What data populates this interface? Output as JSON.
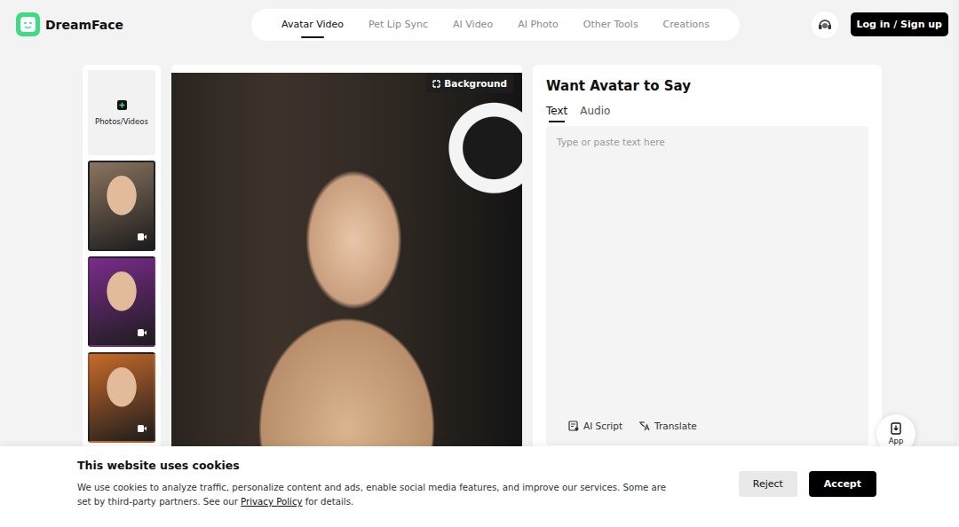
{
  "header": {
    "logo": "DreamFace",
    "nav": [
      {
        "label": "Avatar Video",
        "selected": true
      },
      {
        "label": "Pet Lip Sync",
        "selected": false
      },
      {
        "label": "AI Video",
        "selected": false
      },
      {
        "label": "AI Photo",
        "selected": false
      },
      {
        "label": "Other Tools",
        "selected": false
      },
      {
        "label": "Creations",
        "selected": false
      }
    ],
    "login": "Log in / Sign up"
  },
  "media": {
    "upload": "Photos/Videos",
    "thumbnails": [
      {
        "selected": true,
        "color": "#8a7460"
      },
      {
        "selected": false,
        "color": "#7a2c8c"
      },
      {
        "selected": false,
        "color": "#c86a2a"
      }
    ]
  },
  "preview": {
    "background_button": "Background"
  },
  "panel": {
    "title": "Want Avatar to Say",
    "tabs": [
      {
        "label": "Text",
        "selected": true
      },
      {
        "label": "Audio",
        "selected": false
      }
    ],
    "placeholder": "Type or paste text here",
    "tools": [
      "AI Script",
      "Translate"
    ]
  },
  "app_button": "App",
  "cookie": {
    "title": "This website uses cookies",
    "text": "We use cookies to analyze traffic, personalize content and ads, enable social media features, and improve our services. Some are set by third-party partners. See our ",
    "link": "Privacy Policy",
    "tail": " for details.",
    "buttons": [
      "Reject",
      "Accept"
    ]
  }
}
